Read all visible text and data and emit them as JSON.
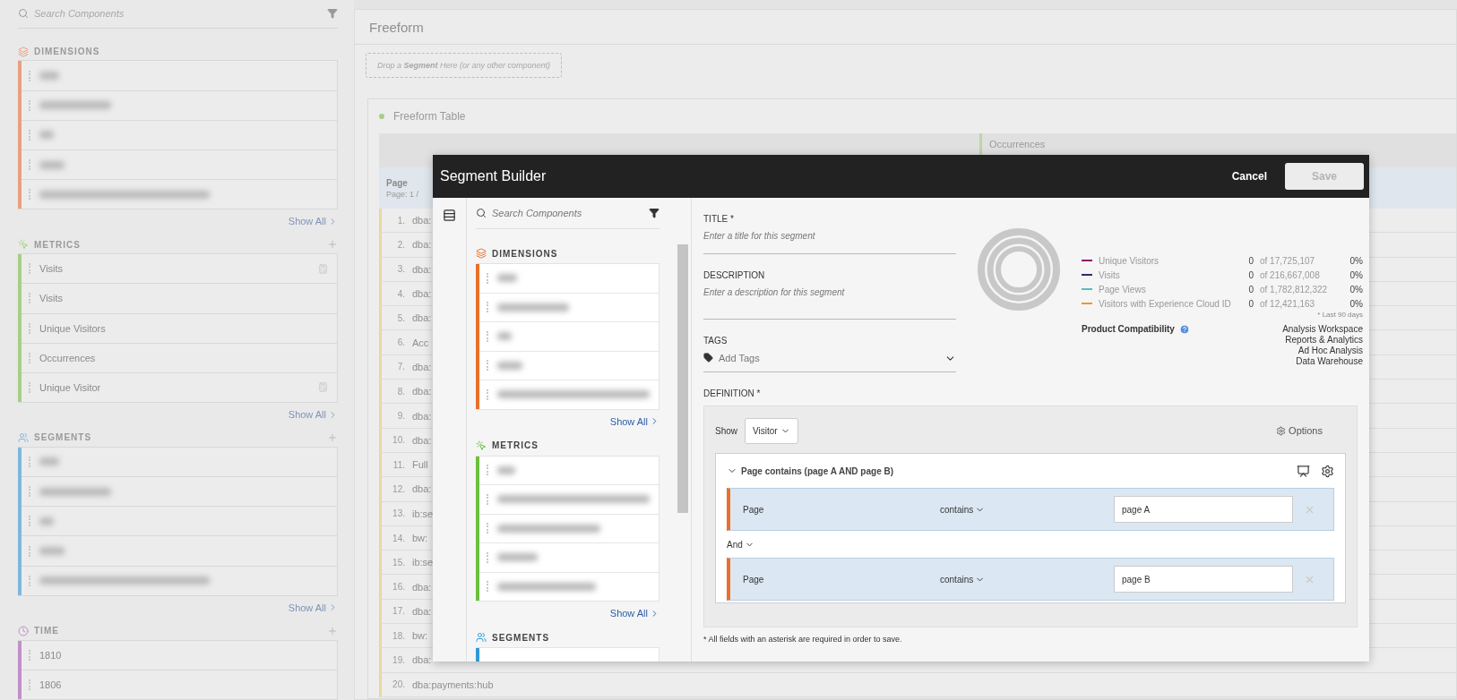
{
  "sidebar": {
    "search": {
      "placeholder": "Search Components"
    },
    "sections": [
      {
        "title": "DIMENSIONS",
        "kind": "dimensions",
        "color": "#e8a07f",
        "add": false,
        "items": [
          {
            "kind": "blurred"
          },
          {
            "kind": "blurred"
          },
          {
            "kind": "blurred"
          },
          {
            "kind": "blurred"
          },
          {
            "kind": "blurred"
          }
        ],
        "show_all": "Show All"
      },
      {
        "title": "METRICS",
        "kind": "metrics",
        "color": "#a6cf85",
        "add": true,
        "items": [
          {
            "kind": "text",
            "label": "Visits",
            "calculated": true
          },
          {
            "kind": "text",
            "label": "Visits",
            "calculated": false
          },
          {
            "kind": "text",
            "label": "Unique Visitors",
            "calculated": false
          },
          {
            "kind": "text",
            "label": "Occurrences",
            "calculated": false
          },
          {
            "kind": "text",
            "label": "Unique Visitor",
            "calculated": true
          }
        ],
        "show_all": "Show All"
      },
      {
        "title": "SEGMENTS",
        "kind": "segments",
        "color": "#7fb6d9",
        "add": true,
        "items": [
          {
            "kind": "blurred"
          },
          {
            "kind": "blurred"
          },
          {
            "kind": "blurred"
          },
          {
            "kind": "blurred"
          },
          {
            "kind": "blurred"
          }
        ],
        "show_all": "Show All"
      },
      {
        "title": "TIME",
        "kind": "time",
        "color": "#c090c8",
        "add": true,
        "items": [
          {
            "kind": "text",
            "label": "1810",
            "calculated": false
          },
          {
            "kind": "text",
            "label": "1806",
            "calculated": false
          }
        ]
      }
    ]
  },
  "main": {
    "title": "Freeform",
    "drop_zone": "Drop a **Segment** Here (or any other component)",
    "panel": {
      "title": "Freeform Table",
      "column_header": "Occurrences",
      "row_header": "Page",
      "row_header_sub": "Page: 1 /",
      "rows": [
        {
          "number": "1.",
          "label": "dba:"
        },
        {
          "number": "2.",
          "label": "dba:"
        },
        {
          "number": "3.",
          "label": "dba:"
        },
        {
          "number": "4.",
          "label": "dba:"
        },
        {
          "number": "5.",
          "label": "dba:"
        },
        {
          "number": "6.",
          "label": "Acc"
        },
        {
          "number": "7.",
          "label": "dba:"
        },
        {
          "number": "8.",
          "label": "dba:"
        },
        {
          "number": "9.",
          "label": "dba:"
        },
        {
          "number": "10.",
          "label": "dba:"
        },
        {
          "number": "11.",
          "label": "Full"
        },
        {
          "number": "12.",
          "label": "dba:"
        },
        {
          "number": "13.",
          "label": "ib:se"
        },
        {
          "number": "14.",
          "label": "bw:"
        },
        {
          "number": "15.",
          "label": "ib:se"
        },
        {
          "number": "16.",
          "label": "dba:"
        },
        {
          "number": "17.",
          "label": "dba:"
        },
        {
          "number": "18.",
          "label": "bw:"
        },
        {
          "number": "19.",
          "label": "dba:"
        },
        {
          "number": "20.",
          "label": "dba:payments:hub"
        }
      ]
    }
  },
  "modal": {
    "title": "Segment Builder",
    "cancel": "Cancel",
    "save": {
      "label": "Save",
      "disabled": true
    },
    "panel": {
      "search": {
        "placeholder": "Search Components"
      },
      "sections": [
        {
          "title": "DIMENSIONS",
          "kind": "dimensions",
          "color": "#e8702a",
          "items": [
            {
              "kind": "blurred"
            },
            {
              "kind": "blurred"
            },
            {
              "kind": "blurred"
            },
            {
              "kind": "blurred"
            },
            {
              "kind": "blurred"
            }
          ],
          "show_all": "Show All"
        },
        {
          "title": "METRICS",
          "kind": "metrics",
          "color": "#6bbf3c",
          "items": [
            {
              "kind": "blurred"
            },
            {
              "kind": "blurred"
            },
            {
              "kind": "blurred"
            },
            {
              "kind": "blurred"
            },
            {
              "kind": "blurred"
            }
          ],
          "show_all": "Show All"
        },
        {
          "title": "SEGMENTS",
          "kind": "segments",
          "color": "#2d9ad8"
        }
      ]
    },
    "form": {
      "title_label": "TITLE *",
      "title_placeholder": "Enter a title for this segment",
      "description_label": "DESCRIPTION",
      "description_placeholder": "Enter a description for this segment",
      "tags_label": "TAGS",
      "tags_placeholder": "Add Tags",
      "definition_label": "DEFINITION *",
      "show_label": "Show",
      "show_value": "Visitor",
      "options": "Options",
      "container": {
        "title": "Page contains (page A AND page B)",
        "expanded": true,
        "connector": "And",
        "rules": [
          {
            "dimension": "Page",
            "operator": "contains",
            "value": "page A"
          },
          {
            "dimension": "Page",
            "operator": "contains",
            "value": "page B"
          }
        ]
      },
      "footnote": "* All fields with an asterisk are required in order to save."
    },
    "summary": {
      "metrics": [
        {
          "name": "Unique Visitors",
          "color": "#8b1a6b",
          "count": "0",
          "total": "of 17,725,107",
          "percent": "0%"
        },
        {
          "name": "Visits",
          "color": "#2b2d6e",
          "count": "0",
          "total": "of 216,667,008",
          "percent": "0%"
        },
        {
          "name": "Page Views",
          "color": "#4fc1c0",
          "count": "0",
          "total": "of 1,782,812,322",
          "percent": "0%"
        },
        {
          "name": "Visitors with Experience Cloud ID",
          "color": "#e89a2e",
          "count": "0",
          "total": "of 12,421,163",
          "percent": "0%"
        }
      ],
      "note": "* Last 90 days",
      "compatibility": {
        "label": "Product Compatibility",
        "products": [
          "Analysis Workspace",
          "Reports & Analytics",
          "Ad Hoc Analysis",
          "Data Warehouse"
        ]
      }
    }
  }
}
